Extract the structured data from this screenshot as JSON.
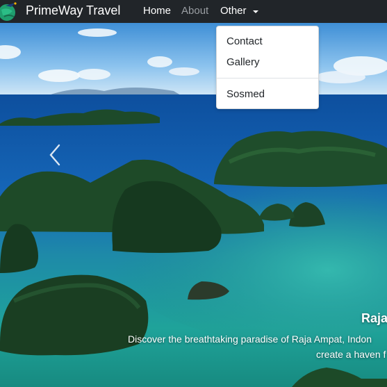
{
  "navbar": {
    "brand": "PrimeWay Travel",
    "logo_icon": "globe-plane-icon",
    "links": {
      "home": "Home",
      "about": "About",
      "other": "Other"
    },
    "active_color": "#ffffff",
    "muted_color": "#9a9ea3",
    "background": "#212529"
  },
  "dropdown": {
    "items": [
      "Contact",
      "Gallery",
      "Sosmed"
    ]
  },
  "carousel": {
    "prev_icon": "chevron-left-icon",
    "caption_title": "Raja",
    "caption_line1": "Discover the breathtaking paradise of Raja Ampat, Indon",
    "caption_line2": "create a haven f"
  }
}
